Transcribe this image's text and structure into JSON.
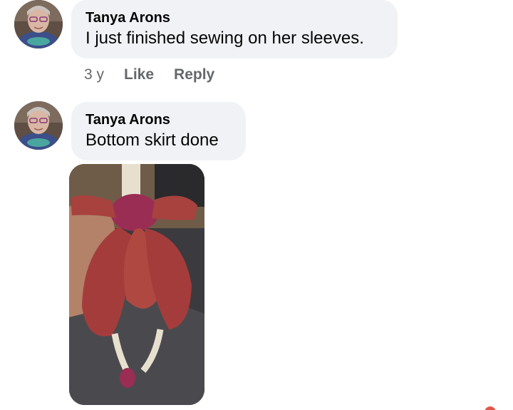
{
  "comments": [
    {
      "author": "Tanya Arons",
      "text": "I just finished sewing on her sleeves.",
      "time": "3 y",
      "like_label": "Like",
      "reply_label": "Reply"
    },
    {
      "author": "Tanya Arons",
      "text": "Bottom skirt done",
      "attachment": "photo"
    }
  ],
  "colors": {
    "bubble_bg": "#f0f2f5",
    "meta_text": "#65676b",
    "body_text": "#050505"
  }
}
